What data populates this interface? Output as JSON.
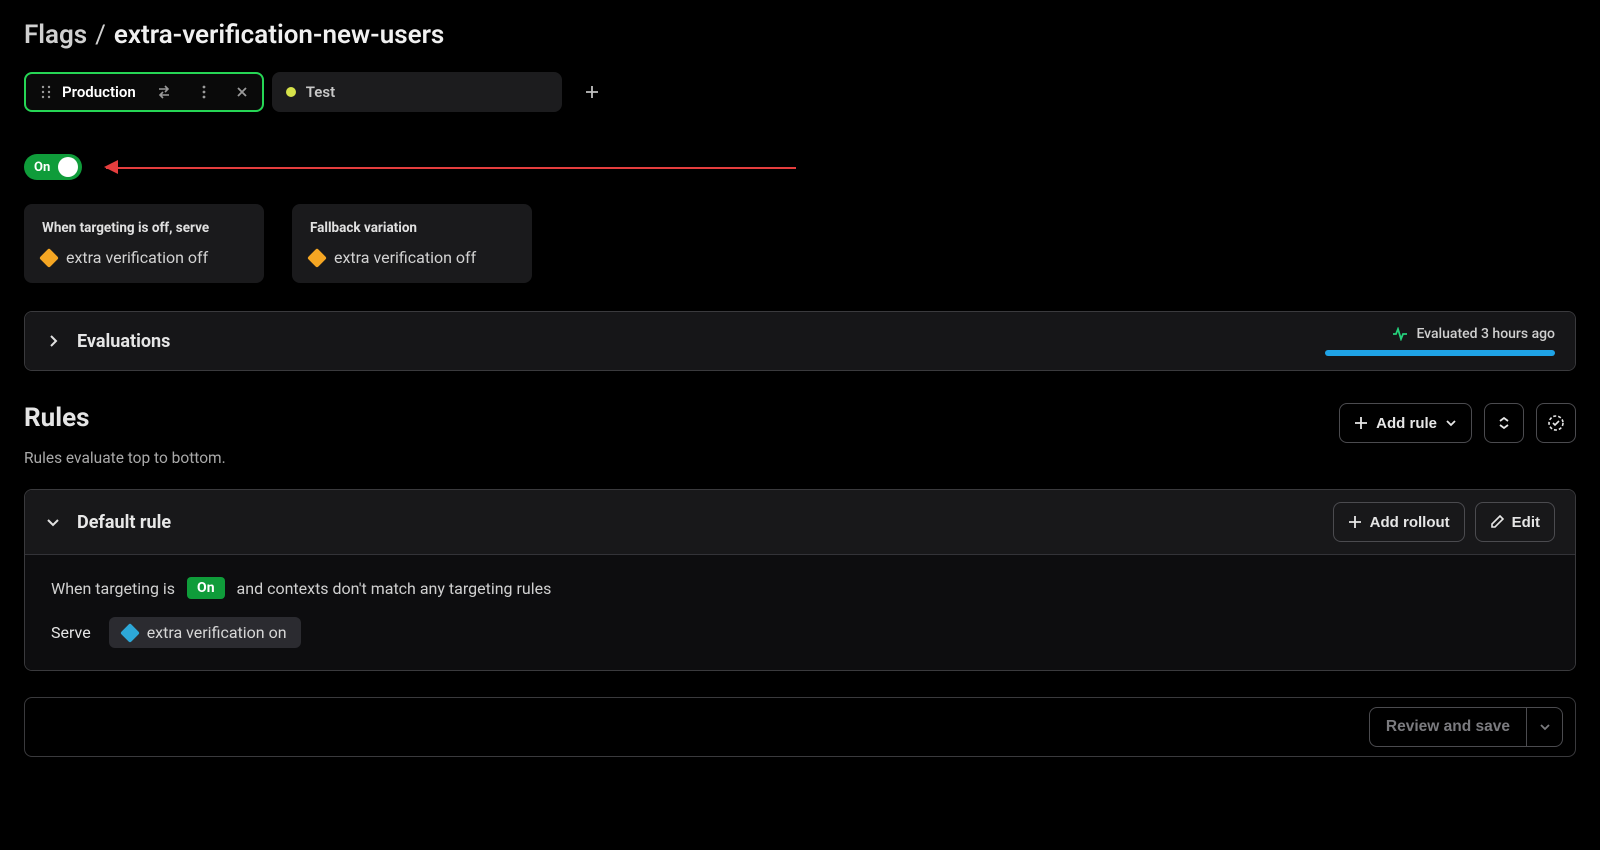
{
  "breadcrumb": {
    "root": "Flags",
    "leaf": "extra-verification-new-users"
  },
  "environments": {
    "active": {
      "name": "Production"
    },
    "others": [
      {
        "name": "Test"
      }
    ]
  },
  "targeting_toggle": {
    "state_label": "On"
  },
  "serve_cards": {
    "off_label": "When targeting is off, serve",
    "off_variation": "extra verification off",
    "fallback_label": "Fallback variation",
    "fallback_variation": "extra verification off"
  },
  "evaluations": {
    "title": "Evaluations",
    "status": "Evaluated 3 hours ago"
  },
  "rules": {
    "title": "Rules",
    "subtitle": "Rules evaluate top to bottom.",
    "add_rule_label": "Add rule"
  },
  "default_rule": {
    "title": "Default rule",
    "add_rollout_label": "Add rollout",
    "edit_label": "Edit",
    "line_prefix": "When targeting is",
    "line_chip": "On",
    "line_suffix": "and contexts don't match any targeting rules",
    "serve_label": "Serve",
    "serve_variation": "extra verification on"
  },
  "footer": {
    "review_label": "Review and save"
  }
}
